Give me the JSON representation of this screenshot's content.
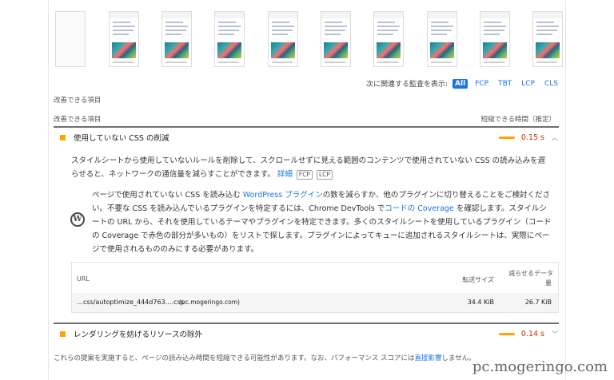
{
  "filter": {
    "label": "次に関連する監査を表示:",
    "chips": [
      "All",
      "FCP",
      "TBT",
      "LCP",
      "CLS"
    ]
  },
  "opportunities": {
    "section_label": "改善できる項目",
    "column_label": "改善できる項目",
    "column_right": "短縮できる時間（推定）"
  },
  "audit1": {
    "title": "使用していない CSS の削減",
    "savings": "0.15 s",
    "description": "スタイルシートから使用していないルールを削除して、スクロールせずに見える範囲のコンテンツで使用されていない CSS の読み込みを遅らせると、ネットワークの通信量を減らすことができます。",
    "learn_more": "詳細",
    "tags": [
      "FCP",
      "LCP"
    ],
    "wp_text_1": "ページで使用されていない CSS を読み込む ",
    "wp_link_1": "WordPress プラグイン",
    "wp_text_2": "の数を減らすか、他のプラグインに切り替えることをご検討ください。不要な CSS を読み込んでいるプラグインを特定するには、Chrome DevTools で",
    "wp_link_2": "コードの Coverage",
    "wp_text_3": " を確認します。スタイルシートの URL から、それを使用しているテーマやプラグインを特定できます。多くのスタイルシートを使用しているプラグイン（コードの Coverage で赤色の部分が多いもの）をリストで探します。プラグインによってキューに追加されるスタイルシートは、実際にページで使用されるもののみにする必要があります。",
    "table": {
      "col_url": "URL",
      "col_size": "転送サイズ",
      "col_savings_1": "減らせるデータ",
      "col_savings_2": "量",
      "rows": [
        {
          "url": "…css/autoptimize_444d763….css",
          "host": "(pc.mogeringo.com)",
          "size": "34.4 KiB",
          "savings": "26.7 KiB"
        }
      ]
    }
  },
  "audit2": {
    "title": "レンダリングを妨げるリソースの除外",
    "savings": "0.14 s"
  },
  "footnote_pre": "これらの提案を実施すると、ページの読み込み時間を短縮できる可能性があります。なお、パフォーマンス スコアには",
  "footnote_link": "直接影響",
  "footnote_post": "しません。",
  "watermark": "pc.mogeringo.com",
  "colors": {
    "accent": "#1a73e8",
    "warning": "#ffa400",
    "savings_text": "#c33300"
  }
}
